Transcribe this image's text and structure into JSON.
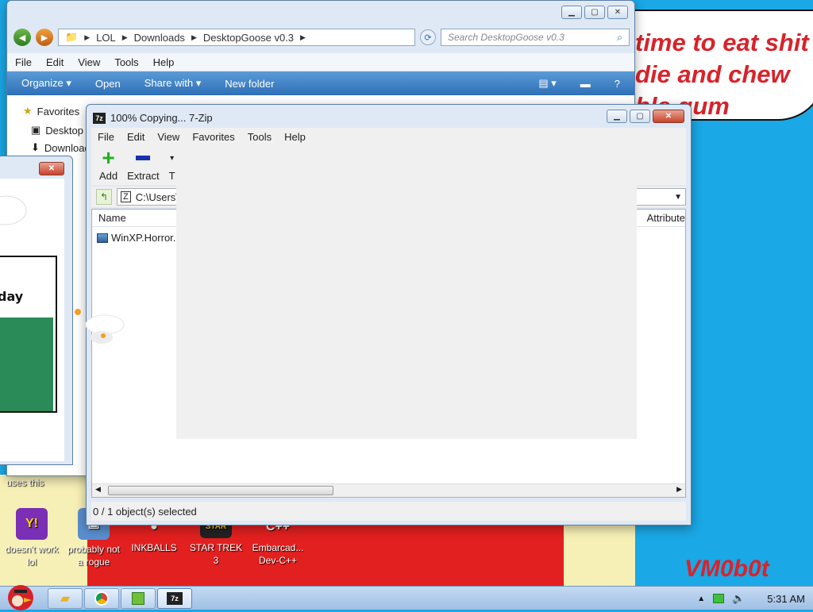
{
  "wallpaper": {
    "text": "time to eat shit\ndie and chew\nble gum",
    "signature": "VM0b0t",
    "uses_label": "uses this"
  },
  "desktop_icons": [
    {
      "label": "doesn't work lol",
      "icon": "yahoo-messenger-icon"
    },
    {
      "label": "probably not a rogue",
      "icon": "computer-icon"
    },
    {
      "label": "INKBALLS",
      "icon": "inkball-icon"
    },
    {
      "label": "STAR TREK 3",
      "icon": "star-wars-icon"
    },
    {
      "label": "Embarcad... Dev-C++",
      "icon": "devcpp-icon"
    }
  ],
  "explorer": {
    "breadcrumb": [
      "LOL",
      "Downloads",
      "DesktopGoose v0.3"
    ],
    "search_placeholder": "Search DesktopGoose v0.3",
    "menu": [
      "File",
      "Edit",
      "View",
      "Tools",
      "Help"
    ],
    "toolbar": [
      "Organize ▾",
      "Open",
      "Share with ▾",
      "New folder"
    ],
    "nav": [
      "Favorites",
      "Desktop",
      "Downloads"
    ]
  },
  "zip": {
    "title": "100% Copying... 7-Zip",
    "menu": [
      "File",
      "Edit",
      "View",
      "Favorites",
      "Tools",
      "Help"
    ],
    "tools": [
      "Add",
      "Extract",
      "T"
    ],
    "path": "C:\\Users\\",
    "columns": {
      "name": "Name",
      "attributes": "Attribute"
    },
    "files": [
      "WinXP.Horror."
    ],
    "status": "0 / 1 object(s) selected"
  },
  "taskbar": {
    "time": "5:31 AM"
  },
  "colors": {
    "wallpaper_blue": "#1aa8e6",
    "wallpaper_red": "#e2201f",
    "wallpaper_text": "#d8232a"
  }
}
